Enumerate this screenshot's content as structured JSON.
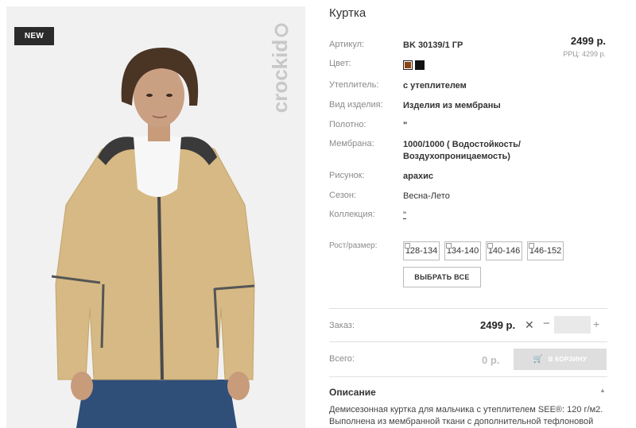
{
  "product": {
    "badge": "NEW",
    "brand_watermark": "crockid",
    "title": "Куртка",
    "price": "2499 р.",
    "rrp": "РРЦ: 4299 р."
  },
  "specs": [
    {
      "label": "Артикул:",
      "value": "BK 30139/1 ГР"
    },
    {
      "label": "Цвет:",
      "value": ""
    },
    {
      "label": "Утеплитель:",
      "value": "с утеплителем"
    },
    {
      "label": "Вид изделия:",
      "value": "Изделия из мембраны"
    },
    {
      "label": "Полотно:",
      "value": "\""
    },
    {
      "label": "Мембрана:",
      "value": "1000/1000 ( Водостойкость/ Воздухопроницаемость)"
    },
    {
      "label": "Рисунок:",
      "value": "арахис"
    },
    {
      "label": "Сезон:",
      "value": "Весна-Лето"
    },
    {
      "label": "Коллекция:",
      "value": "\""
    }
  ],
  "colors": [
    "#8b4513",
    "#111111"
  ],
  "sizes": {
    "label": "Рост/размер:",
    "options": [
      "128-134",
      "134-140",
      "140-146",
      "146-152"
    ],
    "select_all": "ВЫБРАТЬ ВСЕ"
  },
  "order": {
    "label": "Заказ:",
    "price": "2499 р.",
    "qty_value": ""
  },
  "total": {
    "label": "Всего:",
    "value": "0 р.",
    "cart_button": "В КОРЗИНУ"
  },
  "description": {
    "title": "Описание",
    "text": "Демисезонная куртка для мальчика с утеплителем SEE®: 120 г/м2. Выполнена из мембранной ткани с дополнительной тефлоновой"
  }
}
